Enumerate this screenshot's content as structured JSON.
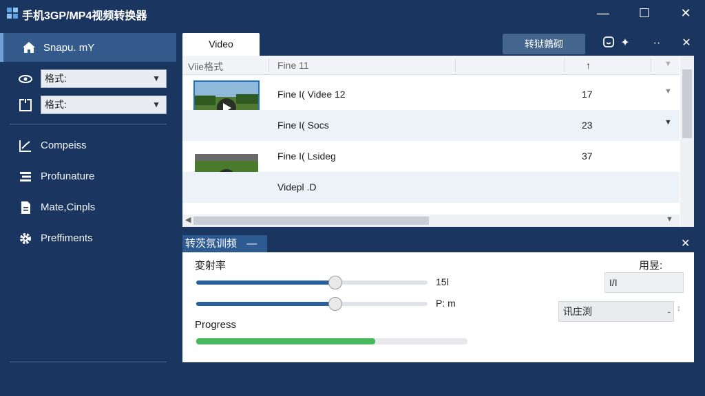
{
  "window": {
    "title": "手机3GP/MP4视频转换器",
    "minimize_label": "—",
    "maximize_label": "☐",
    "close_label": "✕"
  },
  "sidebar": {
    "home_label": "Snapu. mY",
    "format_select_1": "格式:",
    "format_select_2": "格式:",
    "items": [
      {
        "label": "Compeiss",
        "icon": "chart-icon"
      },
      {
        "label": "Profunature",
        "icon": "list-icon"
      },
      {
        "label": "Mate,Cinpls",
        "icon": "document-icon"
      },
      {
        "label": "Preffiments",
        "icon": "gear-icon"
      }
    ]
  },
  "main": {
    "tab_label": "Video",
    "convert_button": "转狱鶉砌",
    "minimize_label": "··",
    "close_label": "✕",
    "headers": {
      "col1": "Viie格式",
      "col2": "Fine 11",
      "col3": "↑"
    },
    "rows": [
      {
        "name": "Fine I( Videe 12",
        "num": "17",
        "action": "▼"
      },
      {
        "name": "Fine I( Socs",
        "num": "23",
        "action": "▼"
      },
      {
        "name": "Fine I( Lsideg",
        "num": "37",
        "action": ""
      },
      {
        "name": "Videpl .D",
        "num": "",
        "action": ""
      }
    ]
  },
  "convert": {
    "tab_label": "转茨氛训频",
    "tab_collapse": "—",
    "close_label": "✕",
    "rate_label": "変射率",
    "slider1_value": "15l",
    "slider2_value": "P: m",
    "progress_label": "Progress",
    "right_label": "用昱:",
    "field_value": "I/I",
    "dropdown_value": "讯庄渕",
    "slider1_level": 0.6,
    "slider2_level": 0.6,
    "progress": 0.66
  },
  "colors": {
    "background": "#1a3560",
    "accent": "#2a5f9e",
    "progress": "#46b95a"
  }
}
